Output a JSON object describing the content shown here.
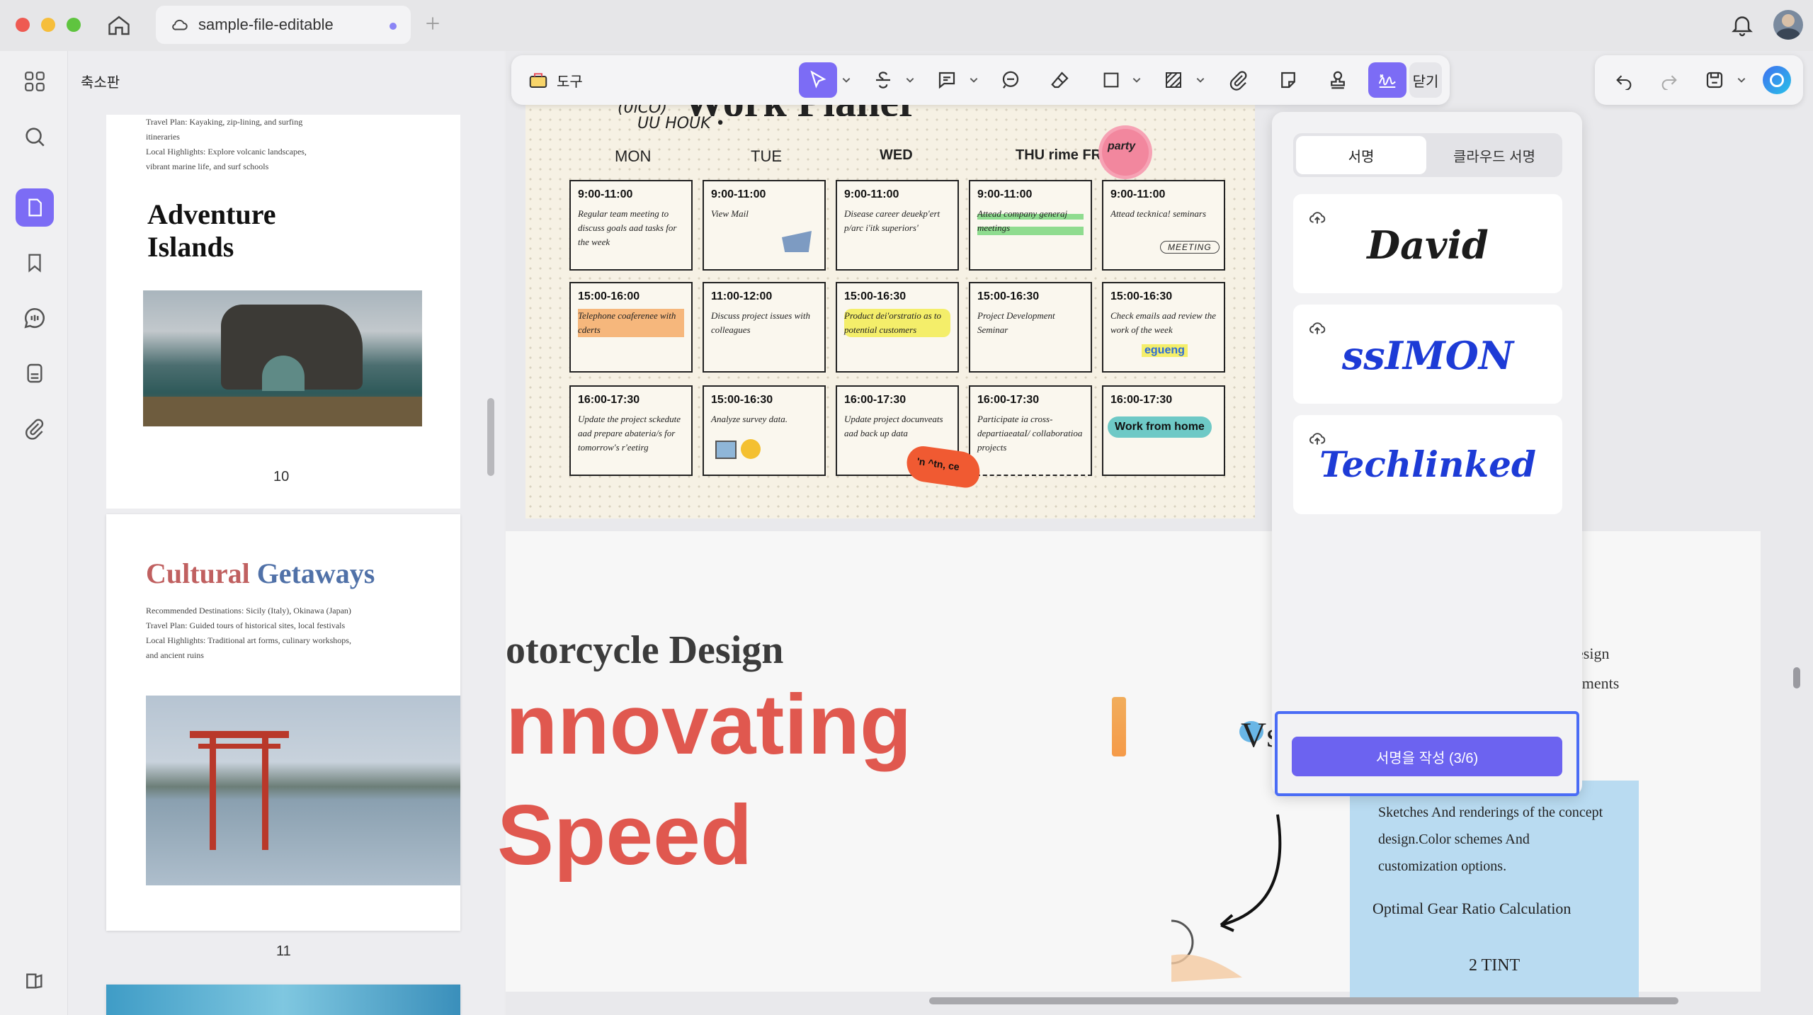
{
  "window": {
    "tab_title": "sample-file-editable"
  },
  "sidebar": {
    "title": "축소판"
  },
  "thumbnails": {
    "page10": {
      "text_lines": [
        "Travel Plan: Kayaking, zip-lining, and surfing",
        "itineraries",
        "Local Highlights: Explore volcanic landscapes,",
        "vibrant marine life, and surf schools"
      ],
      "title_line1": "Adventure",
      "title_line2": "Islands",
      "page_number": "10"
    },
    "page11": {
      "title_word1": "Cultural",
      "title_word2": "Getaways",
      "text_lines": [
        "Recommended Destinations: Sicily (Italy), Okinawa (Japan)",
        "Travel Plan: Guided tours of historical sites, local festivals",
        "Local Highlights: Traditional art forms, culinary workshops,",
        "and ancient ruins"
      ],
      "page_number": "11"
    }
  },
  "toolbar": {
    "tools_label": "도구",
    "close_label": "닫기"
  },
  "planner": {
    "title": "Work Planer",
    "handwriting_1": "(0iCO)",
    "handwriting_2": "UU HOUK •",
    "days": [
      "MON",
      "TUE",
      "WED",
      "THU rime FRI"
    ],
    "sticker_party": "party",
    "rows": [
      [
        {
          "time": "9:00-11:00",
          "note": "Regular team meeting to discuss goals aad tasks for the week"
        },
        {
          "time": "9:00-11:00",
          "note": "View Mail"
        },
        {
          "time": "9:00-11:00",
          "note": "Disease career deuekp'ert p/arc i'itk superiors'"
        },
        {
          "time": "9:00-11:00",
          "note": "Attead company generaj meetings"
        },
        {
          "time": "9:00-11:00",
          "note": "Attead tecknica! seminars"
        }
      ],
      [
        {
          "time": "15:00-16:00",
          "note": "Telephone coaferenee with cderts"
        },
        {
          "time": "11:00-12:00",
          "note": "Discuss project issues with colleagues"
        },
        {
          "time": "15:00-16:30",
          "note": "Product dei'orstratio as to potential customers"
        },
        {
          "time": "15:00-16:30",
          "note": "Project Development Seminar"
        },
        {
          "time": "15:00-16:30",
          "note": "Check emails aad review the work of the week"
        }
      ],
      [
        {
          "time": "16:00-17:30",
          "note": "Update the project sckedute aad prepare abateria/s for tomorrow's r'eetirg"
        },
        {
          "time": "15:00-16:30",
          "note": "Analyze survey data."
        },
        {
          "time": "16:00-17:30",
          "note": "Update project docunveats aad back up data"
        },
        {
          "time": "16:00-17:30",
          "note": "Participate ia cross-departiaeataI/ collaboratioa projects"
        },
        {
          "time": "16:00-17:30",
          "note": ""
        }
      ]
    ],
    "meeting_stamp": "MEETING",
    "sticker_egung": "egueng",
    "sticker_orange": "'n ^tn, ce",
    "work_from_home": "Work from home"
  },
  "lower_page": {
    "heading": "otorcycle Design",
    "big1": "nnovating",
    "big2": "Speed",
    "right_text_1": "esign",
    "right_text_2": "ements",
    "box_text": "Sketches And renderings of the concept design.Color schemes And customization options.",
    "box_heading": "Optimal Gear Ratio Calculation",
    "box_bottom": "2 TINT",
    "vs": "Vs"
  },
  "signature_panel": {
    "tabs": [
      "서명",
      "클라우드 서명"
    ],
    "active_tab": "서명",
    "signatures": [
      {
        "text": "David",
        "color": "#1b1b1b"
      },
      {
        "text": "ssIMON",
        "color": "#1d3bd6"
      },
      {
        "text": "Techlinked",
        "color": "#1d3bd6"
      }
    ],
    "create_button": "서명을 작성 (3/6)"
  }
}
